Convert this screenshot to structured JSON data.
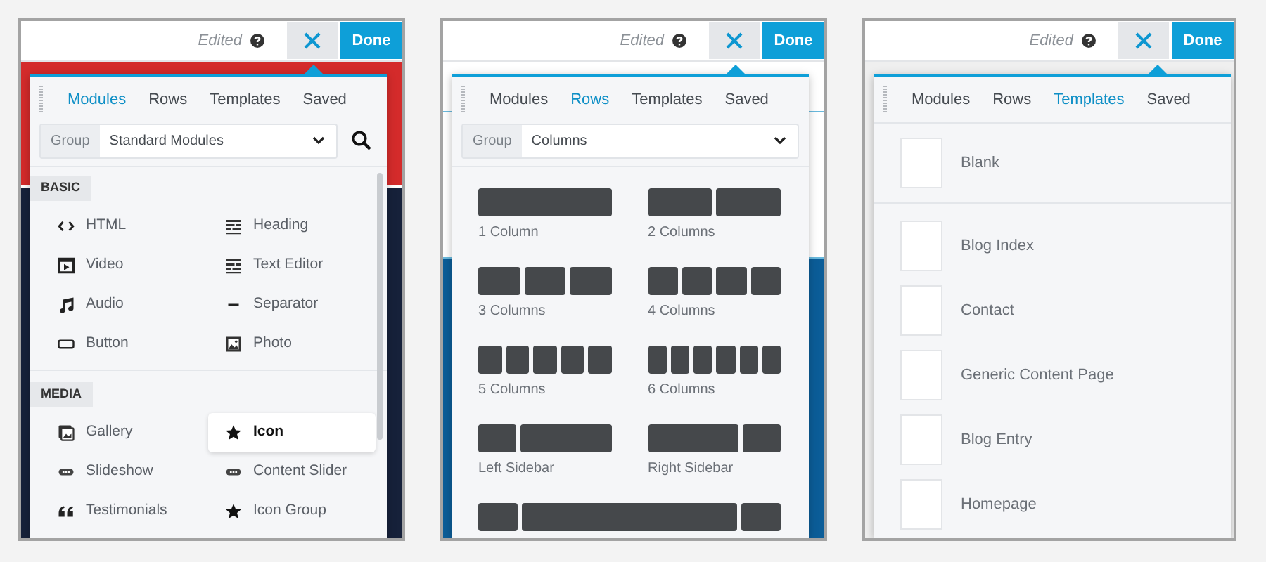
{
  "panels": [
    {
      "kind": "modules",
      "status": "Edited",
      "done": "Done",
      "tabs": [
        {
          "label": "Modules",
          "selected": true
        },
        {
          "label": "Rows",
          "selected": false
        },
        {
          "label": "Templates",
          "selected": false
        },
        {
          "label": "Saved",
          "selected": false
        }
      ],
      "group": {
        "label": "Group",
        "value": "Standard Modules"
      },
      "sections": [
        {
          "title": "BASIC",
          "items": [
            {
              "kind": "code",
              "label": "HTML",
              "selected": false
            },
            {
              "kind": "lines",
              "label": "Heading",
              "selected": false
            },
            {
              "kind": "video",
              "label": "Video",
              "selected": false
            },
            {
              "kind": "lines",
              "label": "Text Editor",
              "selected": false
            },
            {
              "kind": "audio",
              "label": "Audio",
              "selected": false
            },
            {
              "kind": "dash",
              "label": "Separator",
              "selected": false
            },
            {
              "kind": "button",
              "label": "Button",
              "selected": false
            },
            {
              "kind": "photo",
              "label": "Photo",
              "selected": false
            }
          ]
        },
        {
          "title": "MEDIA",
          "items": [
            {
              "kind": "gallery",
              "label": "Gallery",
              "selected": false
            },
            {
              "kind": "star",
              "label": "Icon",
              "selected": true
            },
            {
              "kind": "slider",
              "label": "Slideshow",
              "selected": false
            },
            {
              "kind": "slider",
              "label": "Content Slider",
              "selected": false
            },
            {
              "kind": "quote",
              "label": "Testimonials",
              "selected": false
            },
            {
              "kind": "star",
              "label": "Icon Group",
              "selected": false
            }
          ]
        }
      ]
    },
    {
      "kind": "rows",
      "status": "Edited",
      "done": "Done",
      "tabs": [
        {
          "label": "Modules",
          "selected": false
        },
        {
          "label": "Rows",
          "selected": true
        },
        {
          "label": "Templates",
          "selected": false
        },
        {
          "label": "Saved",
          "selected": false
        }
      ],
      "group": {
        "label": "Group",
        "value": "Columns"
      },
      "layouts": [
        {
          "kind": "one",
          "label": "1 Column"
        },
        {
          "kind": "two",
          "label": "2 Columns"
        },
        {
          "kind": "three",
          "label": "3 Columns"
        },
        {
          "kind": "four",
          "label": "4 Columns"
        },
        {
          "kind": "five",
          "label": "5 Columns"
        },
        {
          "kind": "six",
          "label": "6 Columns"
        },
        {
          "kind": "left-sidebar",
          "label": "Left Sidebar"
        },
        {
          "kind": "right-sidebar",
          "label": "Right Sidebar"
        },
        {
          "kind": "both-sidebars"
        }
      ]
    },
    {
      "kind": "templates",
      "status": "Edited",
      "done": "Done",
      "tabs": [
        {
          "label": "Modules",
          "selected": false
        },
        {
          "label": "Rows",
          "selected": false
        },
        {
          "label": "Templates",
          "selected": true
        },
        {
          "label": "Saved",
          "selected": false
        }
      ],
      "blank": {
        "label": "Blank"
      },
      "templates": [
        {
          "label": "Blog Index"
        },
        {
          "label": "Contact"
        },
        {
          "label": "Generic Content Page"
        },
        {
          "label": "Blog Entry"
        },
        {
          "label": "Homepage"
        }
      ]
    }
  ]
}
